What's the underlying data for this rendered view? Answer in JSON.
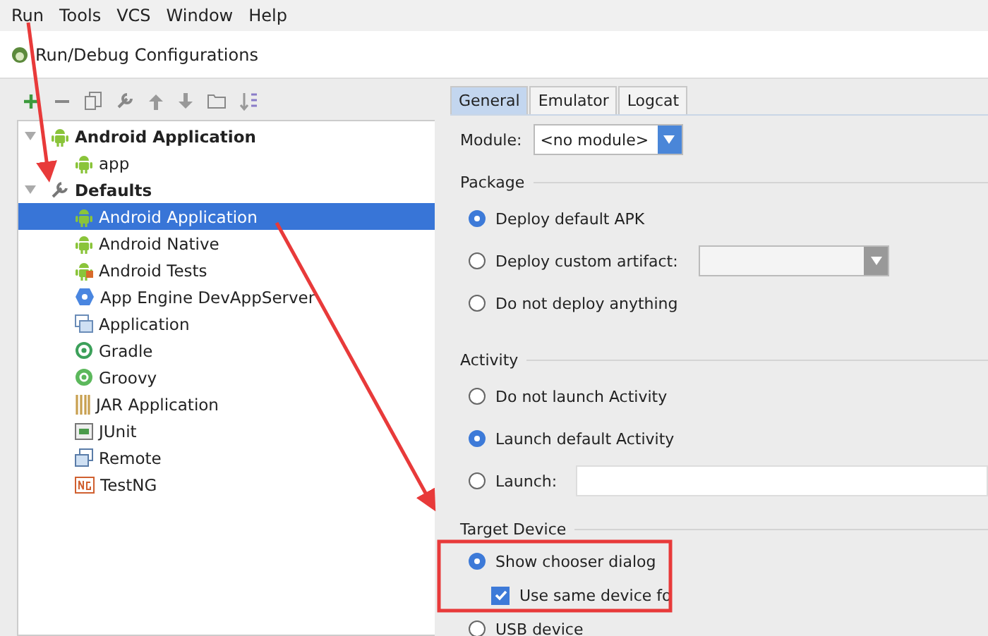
{
  "menu": [
    "Run",
    "Tools",
    "VCS",
    "Window",
    "Help"
  ],
  "window": {
    "title": "Run/Debug Configurations"
  },
  "toolbar": [
    {
      "kind": "add"
    },
    {
      "kind": "remove"
    },
    {
      "kind": "copy"
    },
    {
      "kind": "edit"
    },
    {
      "kind": "up"
    },
    {
      "kind": "down"
    },
    {
      "kind": "folder"
    },
    {
      "kind": "sort"
    }
  ],
  "tree": [
    {
      "label": "Android Application",
      "kind": "android",
      "bold": true,
      "expanded": true,
      "selected": false,
      "children": [
        {
          "label": "app",
          "kind": "android",
          "bold": false,
          "selected": false
        }
      ]
    },
    {
      "label": "Defaults",
      "kind": "wrench",
      "bold": true,
      "expanded": true,
      "selected": false,
      "children": [
        {
          "label": "Android Application",
          "kind": "android",
          "bold": false,
          "selected": true
        },
        {
          "label": "Android Native",
          "kind": "android",
          "bold": false,
          "selected": false
        },
        {
          "label": "Android Tests",
          "kind": "androidtest",
          "bold": false,
          "selected": false
        },
        {
          "label": "App Engine DevAppServer",
          "kind": "appengine",
          "bold": false,
          "selected": false
        },
        {
          "label": "Application",
          "kind": "application",
          "bold": false,
          "selected": false
        },
        {
          "label": "Gradle",
          "kind": "gradle",
          "bold": false,
          "selected": false
        },
        {
          "label": "Groovy",
          "kind": "groovy",
          "bold": false,
          "selected": false
        },
        {
          "label": "JAR Application",
          "kind": "jar",
          "bold": false,
          "selected": false
        },
        {
          "label": "JUnit",
          "kind": "junit",
          "bold": false,
          "selected": false
        },
        {
          "label": "Remote",
          "kind": "remote",
          "bold": false,
          "selected": false
        },
        {
          "label": "TestNG",
          "kind": "testng",
          "bold": false,
          "selected": false
        }
      ]
    }
  ],
  "tabs": [
    {
      "label": "General",
      "selected": true
    },
    {
      "label": "Emulator",
      "selected": false
    },
    {
      "label": "Logcat",
      "selected": false
    }
  ],
  "module": {
    "label": "Module:",
    "value": "<no module>"
  },
  "sections": [
    {
      "title": "Package",
      "options": [
        {
          "label": "Deploy default APK",
          "selected": true
        },
        {
          "label": "Deploy custom artifact:",
          "selected": false,
          "field": {
            "kind": "combo"
          }
        },
        {
          "label": "Do not deploy anything",
          "selected": false
        }
      ]
    },
    {
      "title": "Activity",
      "options": [
        {
          "label": "Do not launch Activity",
          "selected": false
        },
        {
          "label": "Launch default Activity",
          "selected": true
        },
        {
          "label": "Launch:",
          "selected": false,
          "field": {
            "kind": "text"
          }
        }
      ]
    },
    {
      "title": "Target Device",
      "options": [
        {
          "label": "Show chooser dialog",
          "selected": true,
          "checkbox": {
            "label": "Use same device fo",
            "checked": true
          }
        },
        {
          "label": "USB device",
          "selected": false
        }
      ]
    }
  ]
}
